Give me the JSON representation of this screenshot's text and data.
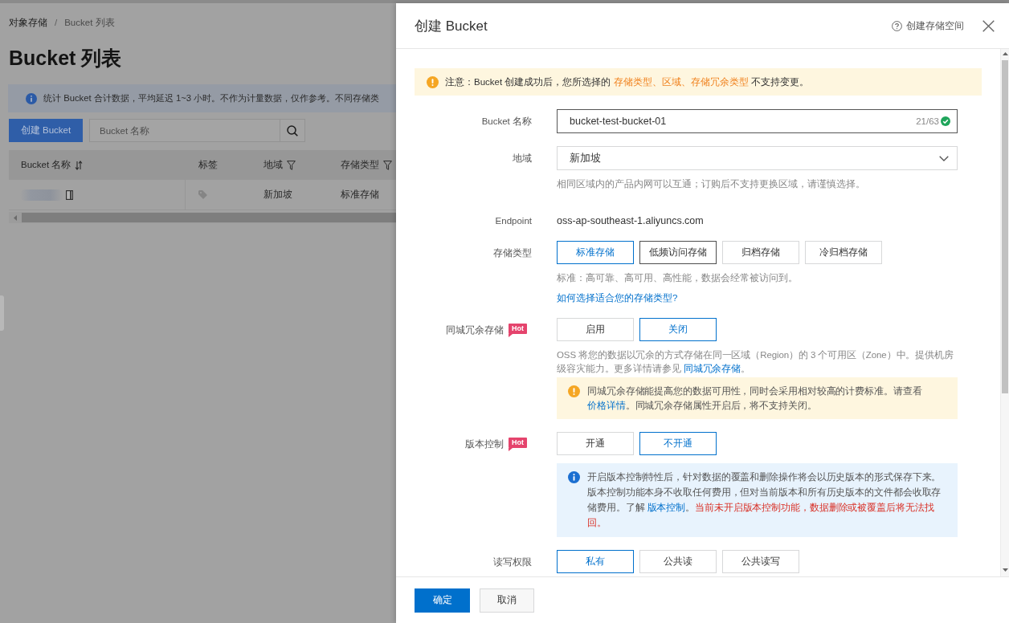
{
  "background_page": {
    "breadcrumb": {
      "items": [
        "对象存储",
        "Bucket 列表"
      ],
      "separator": "/"
    },
    "title": "Bucket 列表",
    "info_banner": "统计 Bucket 合计数据，平均延迟 1~3 小时。不作为计量数据，仅作参考。不同存储类",
    "create_button": "创建 Bucket",
    "search": {
      "placeholder": "Bucket 名称"
    },
    "table": {
      "columns": [
        {
          "label": "Bucket 名称",
          "kind": "sortable"
        },
        {
          "label": "标签",
          "kind": "plain"
        },
        {
          "label": "地域",
          "kind": "filter"
        },
        {
          "label": "存储类型",
          "kind": "filter"
        }
      ],
      "rows": [
        {
          "region": "新加坡",
          "storage_class": "标准存储"
        }
      ]
    }
  },
  "drawer": {
    "title": "创建 Bucket",
    "help_link": "创建存储空间",
    "notice": [
      {
        "text": "注意：Bucket 创建成功后，您所选择的 ",
        "kind": "plain"
      },
      {
        "text": "存储类型、区域、存储冗余类型",
        "kind": "highlight"
      },
      {
        "text": " 不支持变更。",
        "kind": "plain"
      }
    ],
    "fields": [
      {
        "kind": "text_input",
        "label": "Bucket 名称",
        "value": "bucket-test-bucket-01",
        "counter": "21/63",
        "valid": true,
        "focused": true
      },
      {
        "kind": "select",
        "label": "地域",
        "value": "新加坡",
        "help": "相同区域内的产品内网可以互通；订购后不支持更换区域，请谨慎选择。"
      },
      {
        "kind": "static",
        "label": "Endpoint",
        "value": "oss-ap-southeast-1.aliyuncs.com"
      },
      {
        "kind": "options",
        "label": "存储类型",
        "options": [
          {
            "label": "标准存储",
            "selected": true,
            "hovered": false
          },
          {
            "label": "低频访问存储",
            "selected": false,
            "hovered": true
          },
          {
            "label": "归档存储",
            "selected": false,
            "hovered": false
          },
          {
            "label": "冷归档存储",
            "selected": false,
            "hovered": false
          }
        ],
        "help": "标准：高可靠、高可用、高性能，数据会经常被访问到。",
        "link": "如何选择适合您的存储类型?"
      },
      {
        "kind": "options",
        "label": "同城冗余存储",
        "badge": "Hot",
        "options": [
          {
            "label": "启用",
            "selected": false,
            "hovered": false
          },
          {
            "label": "关闭",
            "selected": true,
            "hovered": false
          }
        ],
        "description": [
          {
            "text": "OSS 将您的数据以冗余的方式存储在同一区域（Region）的 3 个可用区（Zone）中。提供机房级容灾能力。更多详情请参见 ",
            "kind": "plain"
          },
          {
            "text": "同城冗余存储",
            "kind": "link"
          },
          {
            "text": "。",
            "kind": "plain"
          }
        ],
        "alert": {
          "kind": "warning",
          "parts": [
            {
              "text": "同城冗余存储能提高您的数据可用性，同时会采用相对较高的计费标准。请查看 ",
              "kind": "plain"
            },
            {
              "text": "价格详情",
              "kind": "link"
            },
            {
              "text": "。同城冗余存储属性开启后，将不支持关闭。",
              "kind": "plain"
            }
          ]
        }
      },
      {
        "kind": "options",
        "label": "版本控制",
        "badge": "Hot",
        "options": [
          {
            "label": "开通",
            "selected": false,
            "hovered": false
          },
          {
            "label": "不开通",
            "selected": true,
            "hovered": false
          }
        ],
        "alert": {
          "kind": "info",
          "parts": [
            {
              "text": "开启版本控制特性后，针对数据的覆盖和删除操作将会以历史版本的形式保存下来。版本控制功能本身不收取任何费用，但对当前版本和所有历史版本的文件都会收取存储费用。了解 ",
              "kind": "plain"
            },
            {
              "text": "版本控制",
              "kind": "link"
            },
            {
              "text": "。",
              "kind": "plain"
            },
            {
              "text": "当前未开启版本控制功能，数据删除或被覆盖后将无法找回。",
              "kind": "danger"
            }
          ]
        }
      },
      {
        "kind": "options",
        "label": "读写权限",
        "options": [
          {
            "label": "私有",
            "selected": true,
            "hovered": false
          },
          {
            "label": "公共读",
            "selected": false,
            "hovered": false
          },
          {
            "label": "公共读写",
            "selected": false,
            "hovered": false
          }
        ]
      }
    ],
    "footer_buttons": [
      {
        "label": "确定",
        "kind": "primary"
      },
      {
        "label": "取消",
        "kind": "secondary"
      }
    ]
  }
}
